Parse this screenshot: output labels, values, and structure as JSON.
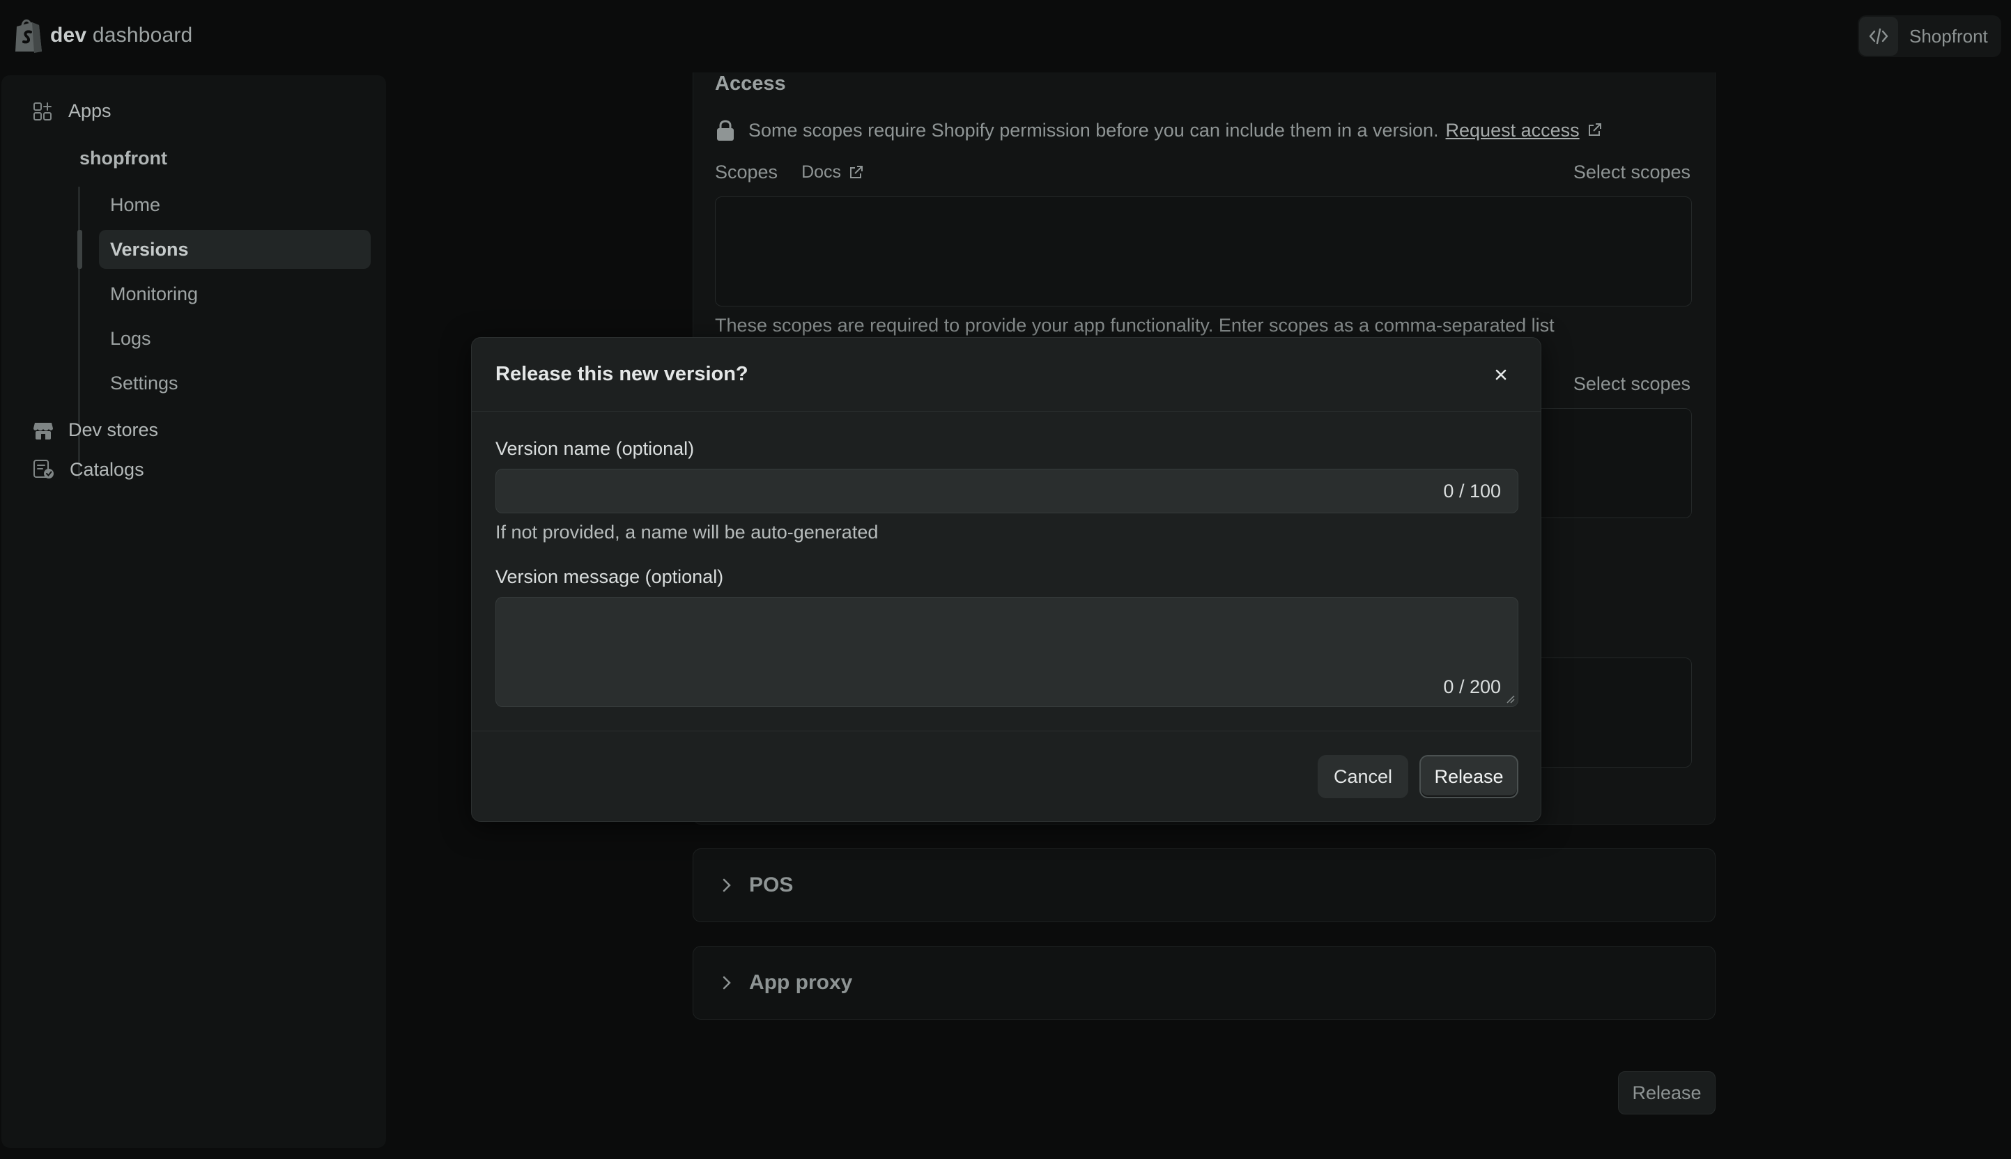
{
  "topbar": {
    "brand_bold": "dev",
    "brand_rest": "dashboard",
    "store_name": "Shopfront",
    "store_icon": "code-icon"
  },
  "sidebar": {
    "apps_label": "Apps",
    "app_name": "shopfront",
    "subnav": [
      {
        "label": "Home",
        "active": false
      },
      {
        "label": "Versions",
        "active": true
      },
      {
        "label": "Monitoring",
        "active": false
      },
      {
        "label": "Logs",
        "active": false
      },
      {
        "label": "Settings",
        "active": false
      }
    ],
    "dev_stores_label": "Dev stores",
    "catalogs_label": "Catalogs"
  },
  "main": {
    "access_title": "Access",
    "access_note": "Some scopes require Shopify permission before you can include them in a version.",
    "request_access_link": "Request access",
    "scopes_label": "Scopes",
    "docs_link": "Docs",
    "select_scopes_1": "Select scopes",
    "select_scopes_2": "Select scopes",
    "scopes_help": "These scopes are required to provide your app functionality. Enter scopes as a comma-separated list",
    "pos_title": "POS",
    "app_proxy_title": "App proxy",
    "release_button": "Release"
  },
  "modal": {
    "title": "Release this new version?",
    "version_name_label": "Version name (optional)",
    "version_name_value": "",
    "version_name_counter": "0 / 100",
    "version_name_help": "If not provided, a name will be auto-generated",
    "version_message_label": "Version message (optional)",
    "version_message_value": "",
    "version_message_counter": "0 / 200",
    "cancel_label": "Cancel",
    "release_label": "Release"
  },
  "colors": {
    "background": "#0b0c0c",
    "modal": "#1d2020",
    "input": "#2a2e2e"
  }
}
